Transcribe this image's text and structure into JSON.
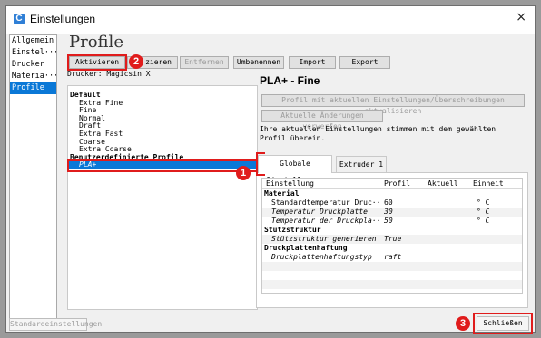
{
  "window": {
    "title": "Einstellungen",
    "close_glyph": "×",
    "app_icon": "C"
  },
  "sidebar": {
    "items": [
      "Allgemein",
      "Einstel···",
      "Drucker",
      "Materia···",
      "Profile"
    ],
    "selected": "Profile"
  },
  "main": {
    "heading": "Profile",
    "toolbar": {
      "aktivieren": "Aktivieren",
      "duplizieren": "zieren",
      "entfernen": "Entfernen",
      "umbenennen": "Umbenennen",
      "import": "Import",
      "export": "Export"
    },
    "drucker_label": "Drucker: Magicsin X",
    "profiles": {
      "default_header": "Default",
      "default_items": [
        "Extra Fine",
        "Fine",
        "Normal",
        "Draft",
        "Extra Fast",
        "Coarse",
        "Extra Coarse"
      ],
      "custom_header": "Benutzerdefinierte Profile",
      "custom_items": [
        "PLA+"
      ]
    }
  },
  "right": {
    "title": "PLA+ - Fine",
    "update_button": "Profil mit aktuellen Einstellungen/Überschreibungen aktualisieren",
    "discard_button": "Aktuelle Änderungen verwerfen",
    "info": "Ihre aktuellen Einstellungen stimmen mit dem gewählten Profil überein.",
    "tabs": [
      "Globale Einstellungen",
      "Extruder 1"
    ],
    "table": {
      "headers": [
        "Einstellung",
        "Profil",
        "Aktuell",
        "Einheit"
      ],
      "groups": [
        {
          "name": "Material",
          "rows": [
            {
              "name": "Standardtemperatur Druc···",
              "profil": "60",
              "unit": "° C"
            },
            {
              "name": "Temperatur Druckplatte",
              "profil": "30",
              "unit": "° C"
            },
            {
              "name": "Temperatur der Druckpla···",
              "profil": "50",
              "unit": "° C"
            }
          ]
        },
        {
          "name": "Stützstruktur",
          "rows": [
            {
              "name": "Stützstruktur generieren",
              "profil": "True",
              "unit": ""
            }
          ]
        },
        {
          "name": "Druckplattenhaftung",
          "rows": [
            {
              "name": "Druckplattenhaftungstyp",
              "profil": "raft",
              "unit": ""
            }
          ]
        }
      ]
    }
  },
  "footer": {
    "defaults": "Standardeinstellungen",
    "close": "Schließen"
  },
  "annotations": {
    "badge1": "1",
    "badge2": "2",
    "badge3": "3"
  },
  "colors": {
    "accent": "#0a78d7",
    "annotation_red": "#e01c1c"
  }
}
